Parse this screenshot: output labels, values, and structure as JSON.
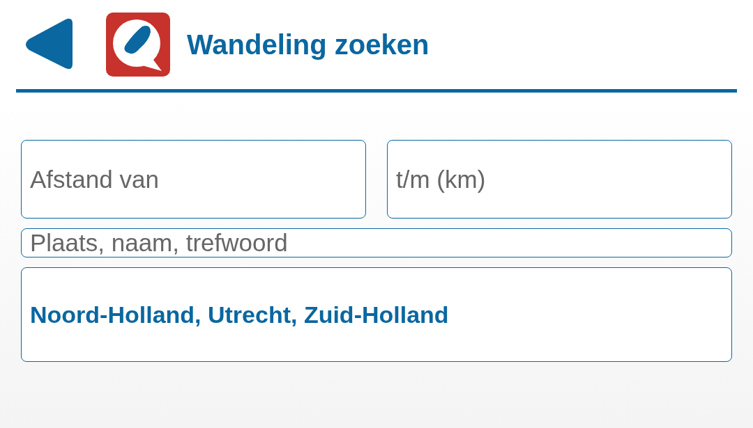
{
  "header": {
    "title": "Wandeling zoeken"
  },
  "fields": [
    {
      "placeholder": "Afstand van"
    },
    {
      "placeholder": "t/m (km)"
    },
    {
      "placeholder": "Plaats, naam, trefwoord"
    }
  ],
  "region_select": {
    "value": "Noord-Holland, Utrecht, Zuid-Holland"
  }
}
